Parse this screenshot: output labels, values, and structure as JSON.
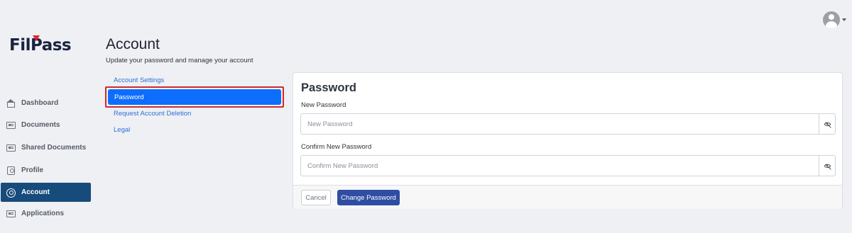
{
  "brand": {
    "logo_text": "FilPass"
  },
  "user_menu": {
    "avatar_icon": "user-avatar-icon"
  },
  "sidebar": {
    "items": [
      {
        "label": "Dashboard",
        "icon": "home-icon"
      },
      {
        "label": "Documents",
        "icon": "id-card-icon"
      },
      {
        "label": "Shared Documents",
        "icon": "id-card-icon"
      },
      {
        "label": "Profile",
        "icon": "profile-badge-icon"
      },
      {
        "label": "Account",
        "icon": "user-circle-icon",
        "active": true
      },
      {
        "label": "Applications",
        "icon": "id-card-icon"
      }
    ]
  },
  "header": {
    "title": "Account",
    "subtitle": "Update your password and manage your account"
  },
  "account_menu": {
    "items": [
      {
        "label": "Account Settings"
      },
      {
        "label": "Password",
        "active": true
      },
      {
        "label": "Request Account Deletion"
      },
      {
        "label": "Legal"
      }
    ]
  },
  "password_card": {
    "title": "Password",
    "new_password": {
      "label": "New Password",
      "placeholder": "New Password",
      "value": ""
    },
    "confirm_password": {
      "label": "Confirm New Password",
      "placeholder": "Confirm New Password",
      "value": ""
    },
    "cancel_label": "Cancel",
    "submit_label": "Change Password"
  },
  "colors": {
    "sidebar_active_bg": "#174b7c",
    "menu_active_bg": "#0d6efd",
    "highlight_border": "#d22a2a",
    "primary_button": "#2f4ea3",
    "link": "#2d6fd6",
    "logo_accent": "#e0262c"
  }
}
